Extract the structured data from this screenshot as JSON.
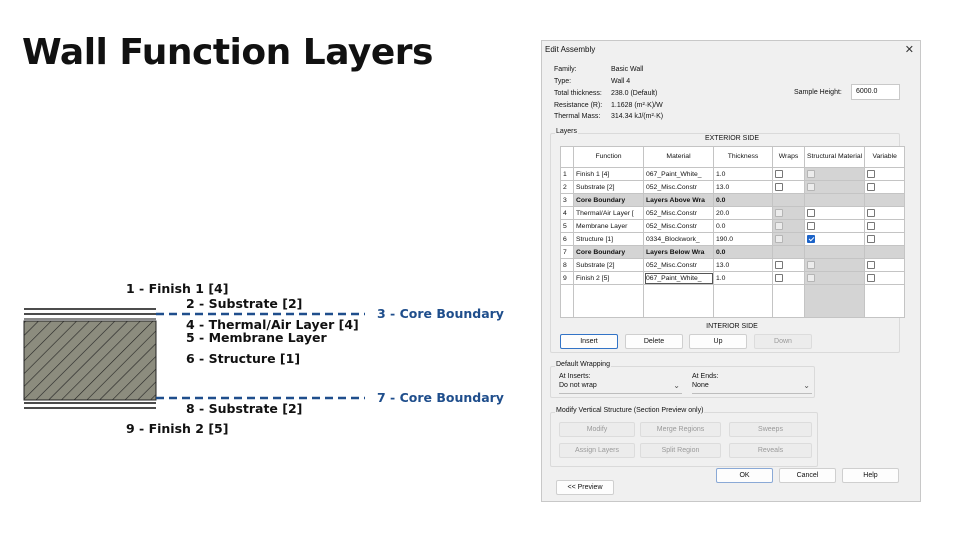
{
  "slide": {
    "title": "Wall Function Layers"
  },
  "diagram": {
    "labels": {
      "finish1": "1 - Finish 1 [4]",
      "substrate2": "2 - Substrate [2]",
      "core3": "3 - Core Boundary",
      "thermal4": "4 - Thermal/Air Layer [4]",
      "membrane5": "5 - Membrane Layer",
      "structure6": "6 - Structure [1]",
      "core7": "7 - Core Boundary",
      "substrate8": "8 - Substrate [2]",
      "finish9": "9 - Finish 2 [5]"
    },
    "colors": {
      "core_line": "#1f4e8c",
      "structure_fill": "#8c8c7e"
    }
  },
  "dialog": {
    "title": "Edit Assembly",
    "info": {
      "family_key": "Family:",
      "family_val": "Basic Wall",
      "type_key": "Type:",
      "type_val": "Wall 4",
      "thickness_key": "Total thickness:",
      "thickness_val": "238.0 (Default)",
      "resistance_key": "Resistance (R):",
      "resistance_val": "1.1628 (m²·K)/W",
      "mass_key": "Thermal Mass:",
      "mass_val": "314.34 kJ/(m²·K)"
    },
    "sample_height_label": "Sample Height:",
    "sample_height_value": "6000.0",
    "layers_label": "Layers",
    "exterior_side": "EXTERIOR SIDE",
    "interior_side": "INTERIOR SIDE",
    "columns": [
      "Function",
      "Material",
      "Thickness",
      "Wraps",
      "Structural Material",
      "Variable"
    ],
    "rows": [
      {
        "n": "1",
        "function": "Finish 1 [4]",
        "material": "067_Paint_White_",
        "thickness": "1.0"
      },
      {
        "n": "2",
        "function": "Substrate [2]",
        "material": "052_Misc.Constr",
        "thickness": "13.0"
      },
      {
        "n": "3",
        "function": "Core Boundary",
        "material": "Layers Above Wra",
        "thickness": "0.0"
      },
      {
        "n": "4",
        "function": "Thermal/Air Layer [",
        "material": "052_Misc.Constr",
        "thickness": "20.0"
      },
      {
        "n": "5",
        "function": "Membrane Layer",
        "material": "052_Misc.Constr",
        "thickness": "0.0"
      },
      {
        "n": "6",
        "function": "Structure [1]",
        "material": "0334_Blockwork_",
        "thickness": "190.0"
      },
      {
        "n": "7",
        "function": "Core Boundary",
        "material": "Layers Below Wra",
        "thickness": "0.0"
      },
      {
        "n": "8",
        "function": "Substrate [2]",
        "material": "052_Misc.Constr",
        "thickness": "13.0"
      },
      {
        "n": "9",
        "function": "Finish 2 [5]",
        "material": "067_Paint_White_",
        "thickness": "1.0"
      }
    ],
    "buttons": {
      "insert": "Insert",
      "delete": "Delete",
      "up": "Up",
      "down": "Down",
      "modify": "Modify",
      "merge": "Merge Regions",
      "sweeps": "Sweeps",
      "assign": "Assign Layers",
      "split": "Split Region",
      "reveals": "Reveals",
      "ok": "OK",
      "cancel": "Cancel",
      "help": "Help",
      "preview": "<< Preview"
    },
    "default_wrapping": {
      "label": "Default Wrapping",
      "inserts_label": "At Inserts:",
      "inserts_value": "Do not wrap",
      "ends_label": "At Ends:",
      "ends_value": "None"
    },
    "modify_vertical_label": "Modify Vertical Structure (Section Preview only)"
  }
}
